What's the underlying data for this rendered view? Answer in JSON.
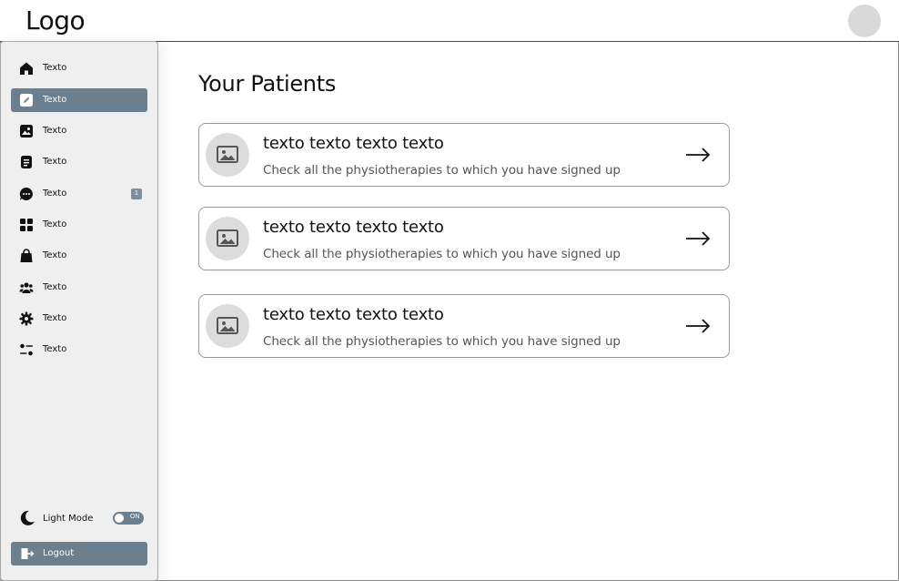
{
  "header": {
    "logo": "Logo"
  },
  "sidebar": {
    "items": [
      {
        "label": "Texto",
        "icon": "home-icon",
        "active": false
      },
      {
        "label": "Texto",
        "icon": "edit-icon",
        "active": true
      },
      {
        "label": "Texto",
        "icon": "image-icon",
        "active": false
      },
      {
        "label": "Texto",
        "icon": "document-icon",
        "active": false
      },
      {
        "label": "Texto",
        "icon": "chat-icon",
        "active": false,
        "badge": "1"
      },
      {
        "label": "Texto",
        "icon": "grid-icon",
        "active": false
      },
      {
        "label": "Texto",
        "icon": "bag-icon",
        "active": false
      },
      {
        "label": "Texto",
        "icon": "users-icon",
        "active": false
      },
      {
        "label": "Texto",
        "icon": "gear-icon",
        "active": false
      },
      {
        "label": "Texto",
        "icon": "sliders-icon",
        "active": false
      }
    ],
    "mode": {
      "label": "Light Mode",
      "toggle_text": "ON",
      "icon": "moon-icon"
    },
    "logout": {
      "label": "Logout",
      "icon": "logout-icon"
    }
  },
  "main": {
    "title": "Your Patients",
    "cards": [
      {
        "title": "texto texto texto texto",
        "subtitle": "Check all the physiotherapies to which you have signed up"
      },
      {
        "title": "texto texto texto texto",
        "subtitle": "Check all the physiotherapies to which you have signed up"
      },
      {
        "title": "texto texto texto texto",
        "subtitle": "Check all the physiotherapies to which you have signed up"
      }
    ]
  },
  "colors": {
    "accent": "#6b7f8e",
    "sidebar_bg": "#efefef",
    "avatar": "#d9d9d9"
  }
}
